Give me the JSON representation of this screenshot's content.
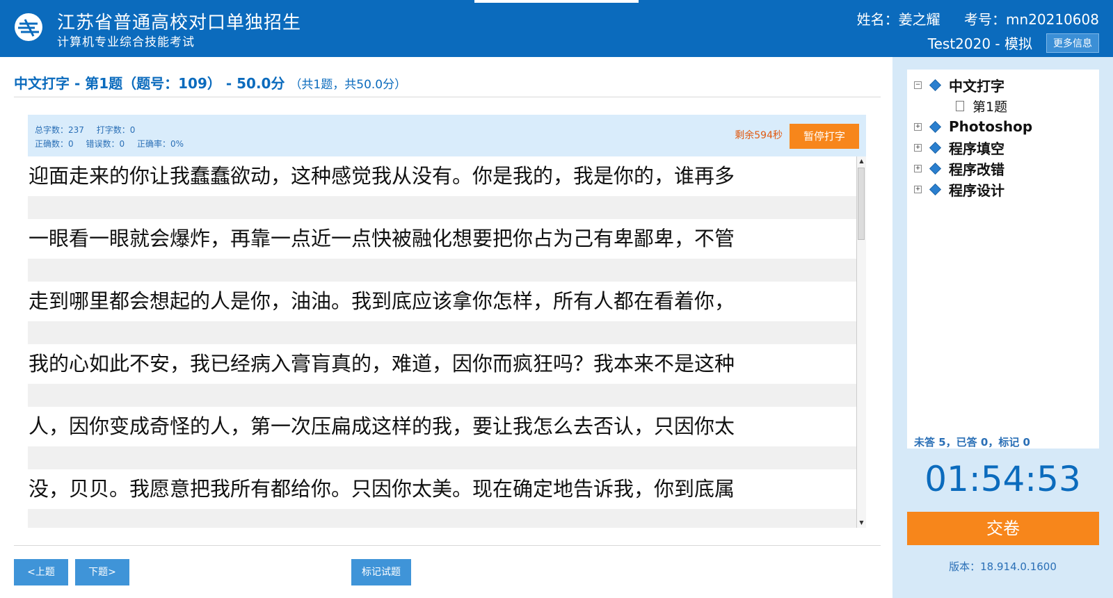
{
  "header": {
    "title": "江苏省普通高校对口单独招生",
    "subtitle": "计算机专业综合技能考试",
    "name": "姓名：姜之耀",
    "exam_no": "考号：mn20210608",
    "mode": "Test2020 - 模拟",
    "more_label": "更多信息"
  },
  "question": {
    "title": "中文打字 - 第1题（题号：109） - 50.0分",
    "summary": "（共1题，共50.0分）"
  },
  "stats": {
    "total": "总字数：237",
    "typed": "打字数：0",
    "correct": "正确数：0",
    "wrong": "错误数：0",
    "accuracy": "正确率：0%",
    "remaining": "剩余594秒",
    "pause_label": "暂停打字"
  },
  "lines": [
    "迎面走来的你让我蠢蠢欲动，这种感觉我从没有。你是我的，我是你的，谁再多",
    "一眼看一眼就会爆炸，再靠一点近一点快被融化想要把你占为己有卑鄙卑，不管",
    "走到哪里都会想起的人是你，油油。我到底应该拿你怎样，所有人都在看着你，",
    "我的心如此不安，我已经病入膏肓真的，难道，因你而疯狂吗？我本来不是这种",
    "人，因你变成奇怪的人，第一次压扁成这样的我，要让我怎么去否认，只因你太",
    "没，贝贝。我愿意把我所有都给你。只因你太美。现在确定地告诉我，你到底属"
  ],
  "nav": {
    "prev": "<上题",
    "next": "下题>",
    "mark": "标记试题"
  },
  "tree": {
    "root": "中文打字",
    "child": "第1题",
    "items": [
      "Photoshop",
      "程序填空",
      "程序改错",
      "程序设计"
    ],
    "status": "未答 5，已答 0，标记 0"
  },
  "timer": "01:54:53",
  "submit_label": "交卷",
  "version": "版本：18.914.0.1600",
  "colors": {
    "header": "#0b6bbd",
    "accent": "#f7861b",
    "sidebar": "#d6e9f8"
  }
}
